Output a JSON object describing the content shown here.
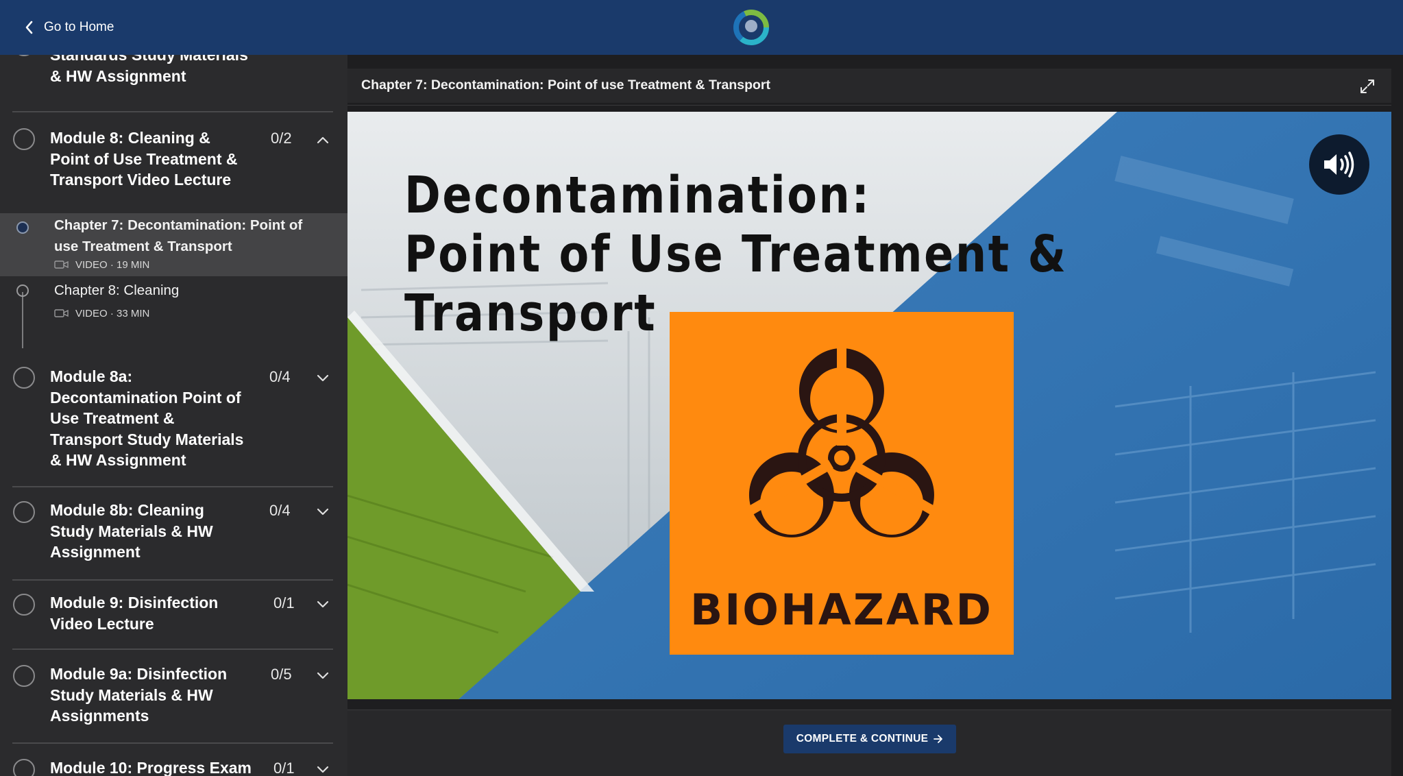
{
  "topbar": {
    "home_label": "Go to Home"
  },
  "sidebar": {
    "modules": [
      {
        "title_lines": [
          "Standards Study Materials",
          "& HW Assignment"
        ],
        "count": "",
        "expanded": false
      },
      {
        "title_lines": [
          "Module 8: Cleaning &",
          "Point of Use Treatment &",
          "Transport Video Lecture"
        ],
        "count": "0/2",
        "expanded": true
      },
      {
        "title_lines": [
          "Module 8a:",
          "Decontamination Point of",
          "Use Treatment &",
          "Transport Study Materials",
          "& HW Assignment"
        ],
        "count": "0/4",
        "expanded": false
      },
      {
        "title_lines": [
          "Module 8b: Cleaning",
          "Study Materials & HW",
          "Assignment"
        ],
        "count": "0/4",
        "expanded": false
      },
      {
        "title_lines": [
          "Module 9: Disinfection",
          "Video Lecture"
        ],
        "count": "0/1",
        "expanded": false
      },
      {
        "title_lines": [
          "Module 9a: Disinfection",
          "Study Materials & HW",
          "Assignments"
        ],
        "count": "0/5",
        "expanded": false
      },
      {
        "title_lines": [
          "Module 10: Progress Exam"
        ],
        "count": "0/1",
        "expanded": false
      }
    ],
    "lessons": [
      {
        "title_lines": [
          "Chapter 7: Decontamination: Point of",
          "use Treatment & Transport"
        ],
        "meta": "VIDEO · 19 MIN",
        "active": true
      },
      {
        "title_lines": [
          "Chapter 8: Cleaning"
        ],
        "meta": "VIDEO · 33 MIN",
        "active": false
      }
    ]
  },
  "player": {
    "header_title": "Chapter 7: Decontamination: Point of use Treatment & Transport",
    "slide_title_lines": [
      "Decontamination:",
      "Point of Use Treatment &",
      "Transport"
    ],
    "sign_text": "BIOHAZARD"
  },
  "footer": {
    "cta_label": "COMPLETE & CONTINUE"
  },
  "colors": {
    "brand_blue": "#1a3a6b",
    "sidebar_bg": "#2b2b2d",
    "active_lesson_bg": "#444446",
    "sign_orange": "#ff8a0f"
  }
}
